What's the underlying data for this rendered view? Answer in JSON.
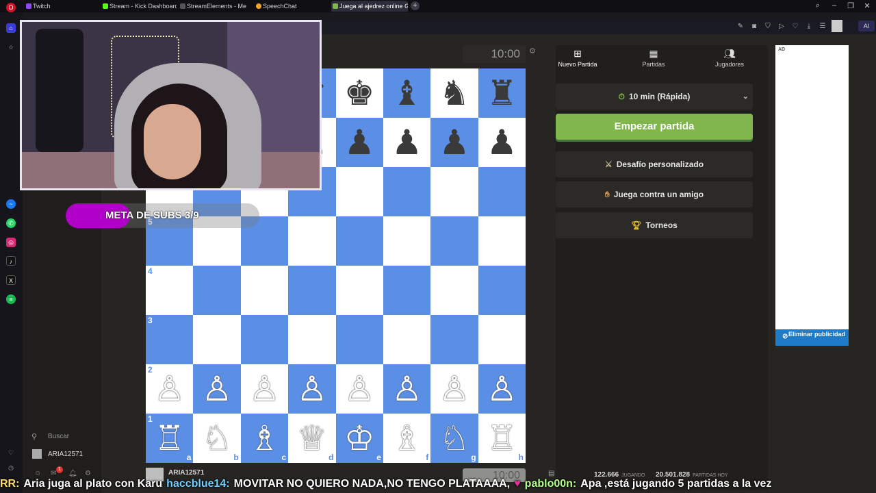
{
  "browser": {
    "tabs": [
      {
        "label": "Twitch",
        "color": "#9146ff"
      },
      {
        "label": "Stream - Kick Dashboard",
        "color": "#53fc18"
      },
      {
        "label": "StreamElements - Me",
        "color": "#3b3b3b"
      },
      {
        "label": "SpeechChat",
        "color": "#f5a623"
      },
      {
        "label": "Juega al ajedrez online G",
        "color": "#81b64c"
      }
    ],
    "new_tab": "+",
    "ai_label": "AI"
  },
  "chess": {
    "clock_top": "10:00",
    "clock_bottom": "10:00",
    "player_name": "ARIA12571",
    "rank_labels": [
      "5",
      "4",
      "3",
      "2",
      "1"
    ],
    "file_labels": [
      "a",
      "b",
      "c",
      "d",
      "e",
      "f",
      "g",
      "h"
    ],
    "board_colors": {
      "light": "#ffffff",
      "dark": "#5b8fe6"
    },
    "pieces": {
      "rank8": [
        "♜",
        "♞",
        "♝",
        "♛",
        "♚",
        "♝",
        "♞",
        "♜"
      ],
      "rank7": [
        "♟",
        "♟",
        "♟",
        "♟",
        "♟",
        "♟",
        "♟",
        "♟"
      ],
      "rank2": [
        "♙",
        "♙",
        "♙",
        "♙",
        "♙",
        "♙",
        "♙",
        "♙"
      ],
      "rank1": [
        "♖",
        "♘",
        "♗",
        "♕",
        "♔",
        "♗",
        "♘",
        "♖"
      ]
    }
  },
  "left_nav": {
    "search_label": "Buscar",
    "user_label": "ARIA12571",
    "notif_count": "1"
  },
  "overlay": {
    "sub_goal": "META DE SUBS  3/9",
    "sub_goal_progress": 0.333
  },
  "panel": {
    "tabs": [
      {
        "label": "Nuevo Partida",
        "icon": "plus-square-icon"
      },
      {
        "label": "Partidas",
        "icon": "board-grid-icon"
      },
      {
        "label": "Jugadores",
        "icon": "players-icon"
      }
    ],
    "time_control": "10 min (Rápida)",
    "start_button": "Empezar partida",
    "buttons": [
      {
        "label": "Desafío personalizado",
        "icon": "custom-challenge-icon"
      },
      {
        "label": "Juega contra un amigo",
        "icon": "handshake-icon"
      },
      {
        "label": "Torneos",
        "icon": "trophy-icon"
      }
    ],
    "accent": "#81b64c"
  },
  "ad": {
    "label": "AD",
    "remove_label": "Eliminar publicidad"
  },
  "stats": {
    "playing_count": "122.666",
    "playing_label": "JUGANDO",
    "games_count": "20.501.828",
    "games_label": "PARTIDAS HOY"
  },
  "ticker": {
    "items": [
      {
        "user": "RR:",
        "msg": "Aria juga al plato con Karu"
      },
      {
        "user": "haccblue14:",
        "msg": "MOVITAR NO QUIERO NADA,NO TENGO PLATAAAA,"
      },
      {
        "user": "pablo00n:",
        "msg": "Apa ,está jugando 5 partidas a la vez"
      }
    ]
  }
}
